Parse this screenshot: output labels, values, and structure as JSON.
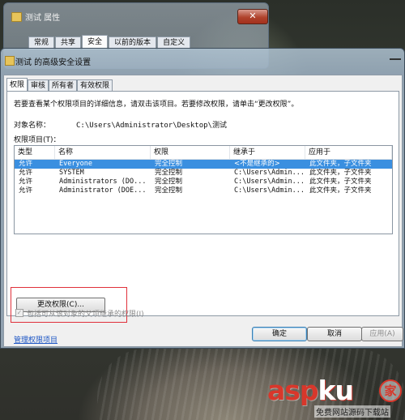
{
  "background_window": {
    "title": "测试 属性",
    "close_symbol": "✕",
    "tabs": [
      {
        "label": "常规"
      },
      {
        "label": "共享"
      },
      {
        "label": "安全",
        "active": true
      },
      {
        "label": "以前的版本"
      },
      {
        "label": "自定义"
      }
    ]
  },
  "dialog": {
    "title": "测试 的高级安全设置",
    "tabs": [
      {
        "label": "权限",
        "active": true
      },
      {
        "label": "审核"
      },
      {
        "label": "所有者"
      },
      {
        "label": "有效权限"
      }
    ],
    "instruction": "若要查看某个权限项目的详细信息，请双击该项目。若要修改权限，请单击“更改权限”。",
    "object_name_label": "对象名称：",
    "object_name_value": "C:\\Users\\Administrator\\Desktop\\测试",
    "entries_label": "权限项目(T)：",
    "table": {
      "columns": [
        "类型",
        "名称",
        "权限",
        "继承于",
        "应用于"
      ],
      "rows": [
        [
          "允许",
          "Everyone",
          "完全控制",
          "<不是继承的>",
          "此文件夹，子文件夹"
        ],
        [
          "允许",
          "SYSTEM",
          "完全控制",
          "C:\\Users\\Admin...",
          "此文件夹，子文件夹"
        ],
        [
          "允许",
          "Administrators (DO...",
          "完全控制",
          "C:\\Users\\Admin...",
          "此文件夹，子文件夹"
        ],
        [
          "允许",
          "Administrator (DOE...",
          "完全控制",
          "C:\\Users\\Admin...",
          "此文件夹，子文件夹"
        ]
      ],
      "selected_row": 0
    },
    "change_permissions_button": "更改权限(C)...",
    "inherit_checkbox": {
      "label": "包括可从该对象的父项继承的权限(I)",
      "checked": true,
      "enabled": false
    },
    "manage_link": "管理权限项目",
    "buttons": {
      "ok": "确定",
      "cancel": "取消",
      "apply": "应用(A)"
    }
  },
  "watermark": {
    "brand_part1": "asp",
    "brand_part2": "ku",
    "seal_char": "家",
    "subtitle": "免费网站源码下载站"
  },
  "colors": {
    "selection": "#3a8fe0",
    "highlight_box": "#e0303a",
    "link": "#1a54c4",
    "watermark_red": "#d8372b"
  }
}
